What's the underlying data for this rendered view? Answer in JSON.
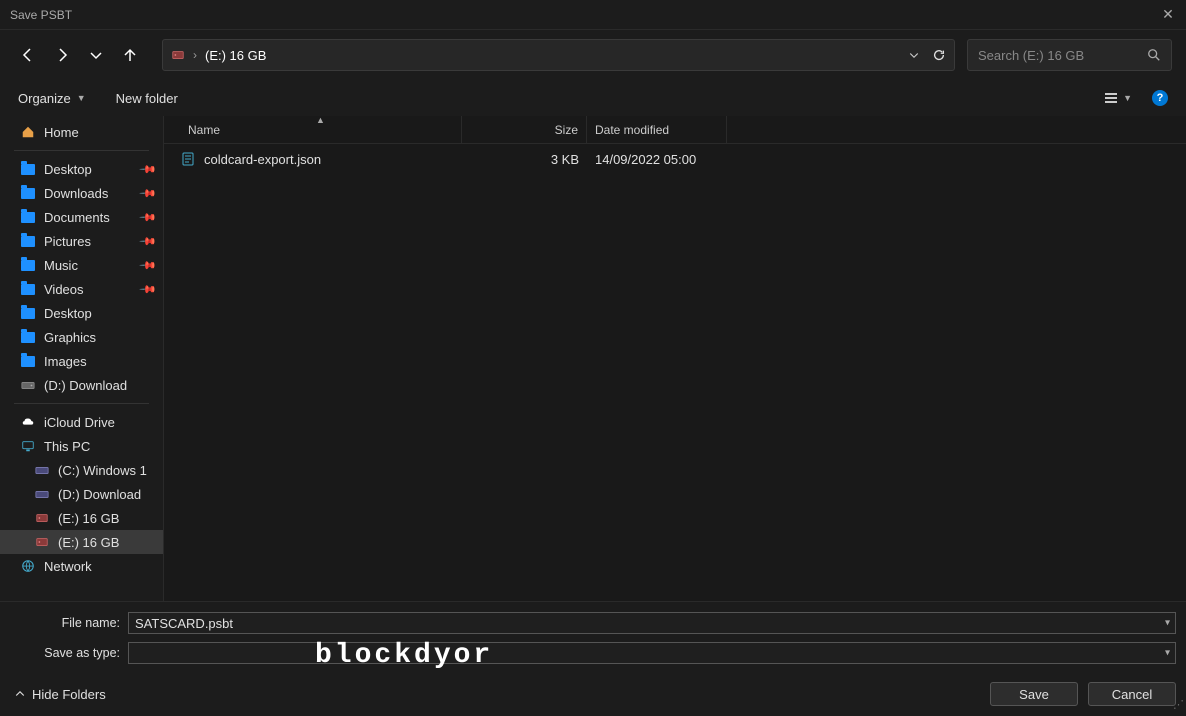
{
  "window": {
    "title": "Save PSBT"
  },
  "address": {
    "location": "(E:) 16 GB"
  },
  "search": {
    "placeholder": "Search (E:) 16 GB"
  },
  "toolbar": {
    "organize": "Organize",
    "new_folder": "New folder"
  },
  "sidebar": {
    "home": "Home",
    "desktop": "Desktop",
    "downloads": "Downloads",
    "documents": "Documents",
    "pictures": "Pictures",
    "music": "Music",
    "videos": "Videos",
    "desktop2": "Desktop",
    "graphics": "Graphics",
    "images": "Images",
    "d_download": "(D:) Download",
    "icloud": "iCloud Drive",
    "this_pc": "This PC",
    "c_windows": "(C:) Windows 1",
    "d_download2": "(D:) Download",
    "e_drive": "(E:) 16 GB",
    "e_drive2": "(E:) 16 GB",
    "network": "Network"
  },
  "columns": {
    "name": "Name",
    "size": "Size",
    "date": "Date modified"
  },
  "files": [
    {
      "name": "coldcard-export.json",
      "size": "3 KB",
      "date": "14/09/2022 05:00"
    }
  ],
  "form": {
    "filename_label": "File name:",
    "filename_value": "SATSCARD.psbt",
    "savetype_label": "Save as type:",
    "savetype_value": ""
  },
  "footer": {
    "hide_folders": "Hide Folders",
    "save": "Save",
    "cancel": "Cancel"
  },
  "watermark": "blockdyor"
}
